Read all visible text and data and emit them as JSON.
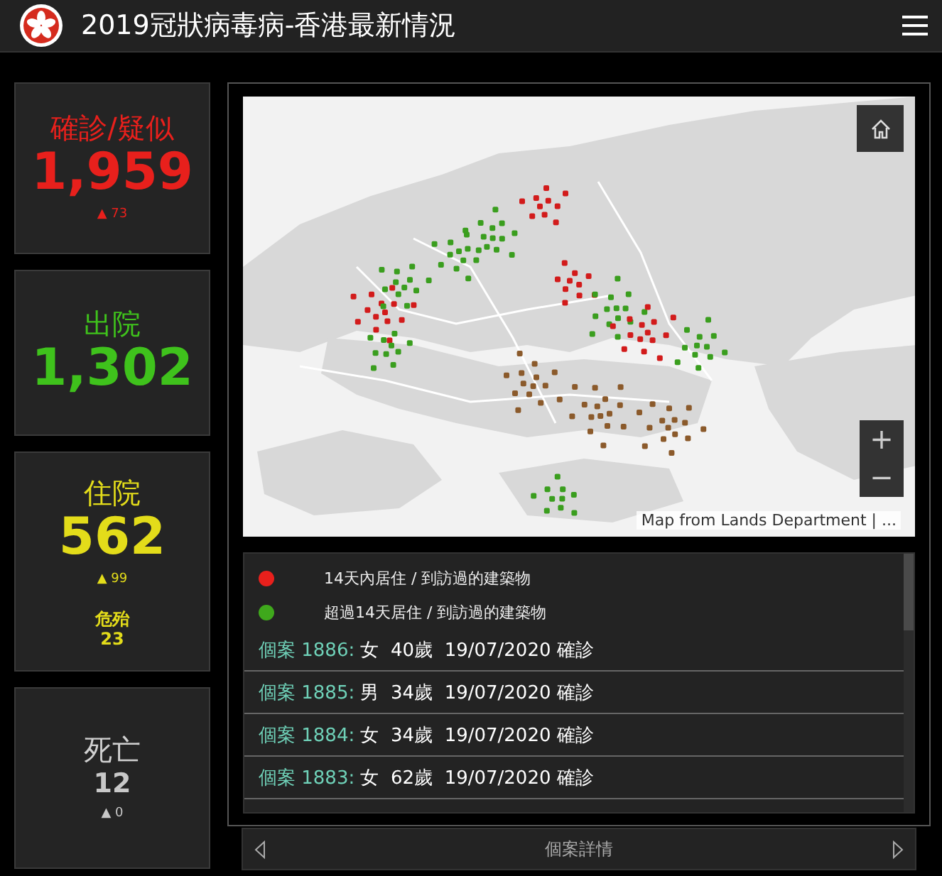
{
  "header": {
    "title": "2019冠狀病毒病-香港最新情況"
  },
  "stats": [
    {
      "label": "確診/疑似",
      "value": "1,959",
      "change": "▲ 73",
      "color": "#e8201c"
    },
    {
      "label": "出院",
      "value": "1,302",
      "color": "#3fc21c"
    },
    {
      "label": "住院",
      "value": "562",
      "change": "▲ 99",
      "sub_label": "危殆",
      "sub_value": "23",
      "color": "#e3dc1a"
    },
    {
      "label": "死亡",
      "value": "12",
      "change": "▲ 0",
      "color": "#c8c8c8"
    }
  ],
  "map": {
    "attribution": "Map from Lands Department | ...",
    "zoom_in": "+",
    "zoom_out": "−"
  },
  "legend": [
    {
      "label": "14天內居住 / 到訪過的建築物",
      "color": "#e8201c"
    },
    {
      "label": "超過14天居住 / 到訪過的建築物",
      "color": "#3fa81c"
    }
  ],
  "cases": [
    {
      "label": "個案 1886:",
      "detail": "女  40歲  19/07/2020 確診"
    },
    {
      "label": "個案 1885:",
      "detail": "男  34歲  19/07/2020 確診"
    },
    {
      "label": "個案 1884:",
      "detail": "女  34歲  19/07/2020 確診"
    },
    {
      "label": "個案 1883:",
      "detail": "女  62歲  19/07/2020 確診"
    }
  ],
  "footer": {
    "title": "個案詳情"
  }
}
